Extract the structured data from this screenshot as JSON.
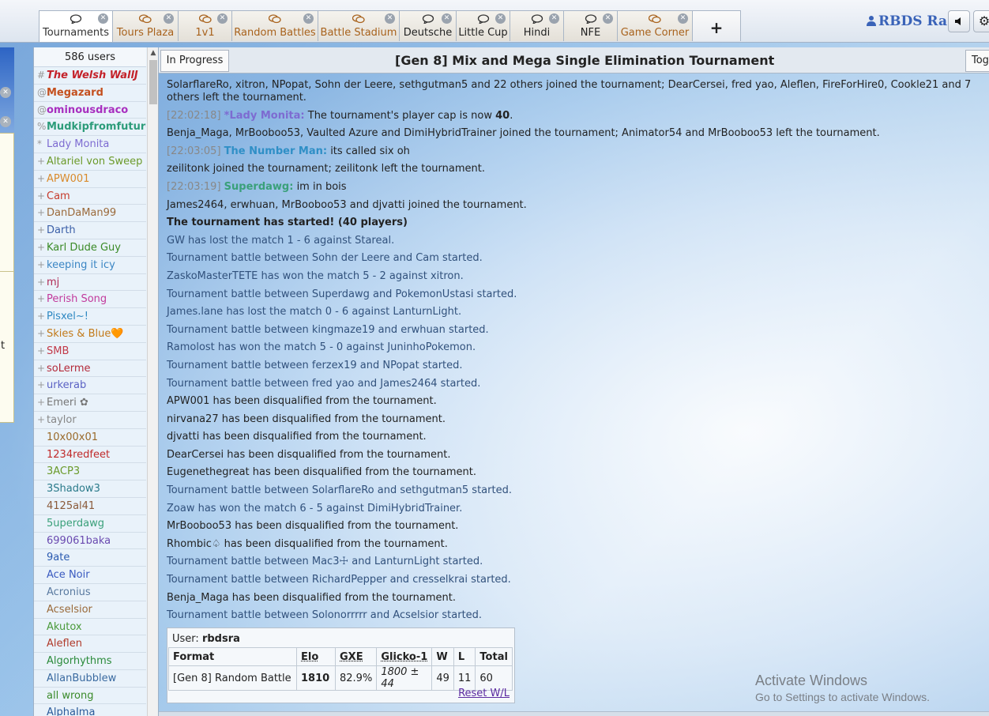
{
  "tabs": [
    {
      "label": "Tournaments",
      "active": true,
      "icon": "chat-bubble-icon",
      "closable": true
    },
    {
      "label": "Tours Plaza",
      "icon": "chat-bubbles-icon",
      "closable": true
    },
    {
      "label": "1v1",
      "icon": "chat-bubbles-icon",
      "closable": true
    },
    {
      "label": "Random Battles",
      "icon": "chat-bubbles-icon",
      "closable": true
    },
    {
      "label": "Battle Stadium",
      "icon": "chat-bubbles-icon",
      "closable": true
    },
    {
      "label": "Deutsche",
      "icon": "chat-bubble-icon",
      "closable": true
    },
    {
      "label": "Little Cup",
      "icon": "chat-bubble-icon",
      "closable": true
    },
    {
      "label": "Hindi",
      "icon": "chat-bubble-icon",
      "closable": true
    },
    {
      "label": "NFE",
      "icon": "chat-bubble-icon",
      "closable": true
    },
    {
      "label": "Game Corner",
      "icon": "chat-bubbles-icon",
      "closable": true
    }
  ],
  "add_tab_label": "+",
  "user": {
    "name": "RBDS Ra",
    "icon": "user-icon"
  },
  "sound_icon": "speaker-icon",
  "settings_icon": "gear-icon",
  "left_panel_partial_text": "t",
  "userlist": {
    "count": "586 users",
    "users": [
      {
        "group": "#",
        "name": "The Welsh WallJ",
        "color": "#c4222a",
        "bold": true,
        "italic": true
      },
      {
        "group": "@",
        "name": "Megazard",
        "color": "#c4501f",
        "bold": true
      },
      {
        "group": "@",
        "name": "ominousdraco",
        "color": "#a82fbf",
        "bold": true
      },
      {
        "group": "%",
        "name": "Mudkipfromfuture",
        "color": "#2d9c7a",
        "bold": true
      },
      {
        "group": "*",
        "name": "Lady Monita",
        "color": "#7d6bd1"
      },
      {
        "group": "+",
        "name": "Altariel von Sweep",
        "color": "#6c9a2a"
      },
      {
        "group": "+",
        "name": "APW001",
        "color": "#d98a2b"
      },
      {
        "group": "+",
        "name": "Cam",
        "color": "#c63a2b"
      },
      {
        "group": "+",
        "name": "DanDaMan99",
        "color": "#9b6a3b"
      },
      {
        "group": "+",
        "name": "Darth",
        "color": "#3b5fa8"
      },
      {
        "group": "+",
        "name": "Karl Dude Guy",
        "color": "#3a8a26"
      },
      {
        "group": "+",
        "name": "keeping it icy",
        "color": "#3b86c4"
      },
      {
        "group": "+",
        "name": "mj",
        "color": "#b02a55"
      },
      {
        "group": "+",
        "name": "Perish Song",
        "color": "#c23a9c"
      },
      {
        "group": "+",
        "name": "Pisxel~!",
        "color": "#2e88c2"
      },
      {
        "group": "+",
        "name": "Skies & Blue🧡",
        "color": "#c27a1a"
      },
      {
        "group": "+",
        "name": "SMB",
        "color": "#c23a4a"
      },
      {
        "group": "+",
        "name": "soLerme",
        "color": "#b42a3a"
      },
      {
        "group": "+",
        "name": "urkerab",
        "color": "#5b62c4"
      },
      {
        "group": "+",
        "name": "Emeri ✿",
        "color": "#777777"
      },
      {
        "group": "+",
        "name": "taylor",
        "color": "#888888"
      },
      {
        "group": "",
        "name": "10x00x01",
        "color": "#9a6a2a"
      },
      {
        "group": "",
        "name": "1234redfeet",
        "color": "#c02a2a"
      },
      {
        "group": "",
        "name": "3ACP3",
        "color": "#6a9a2a"
      },
      {
        "group": "",
        "name": "3Shadow3",
        "color": "#2a7a8a"
      },
      {
        "group": "",
        "name": "4125al41",
        "color": "#8a5a3a"
      },
      {
        "group": "",
        "name": "5uperdawg",
        "color": "#3aa07a"
      },
      {
        "group": "",
        "name": "699061baka",
        "color": "#6a4ab0"
      },
      {
        "group": "",
        "name": "9ate",
        "color": "#2a5ab0"
      },
      {
        "group": "",
        "name": "Ace Noir",
        "color": "#3a5ac0"
      },
      {
        "group": "",
        "name": "Acronius",
        "color": "#5a7aa0"
      },
      {
        "group": "",
        "name": "Acselsior",
        "color": "#9a6a3a"
      },
      {
        "group": "",
        "name": "Akutox",
        "color": "#4a9a3a"
      },
      {
        "group": "",
        "name": "Aleflen",
        "color": "#b03a2a"
      },
      {
        "group": "",
        "name": "Algorhythms",
        "color": "#2a8a3a"
      },
      {
        "group": "",
        "name": "AllanBubblew",
        "color": "#3a6aa0"
      },
      {
        "group": "",
        "name": "all wrong",
        "color": "#3a8a2a"
      },
      {
        "group": "",
        "name": "AlphaIma",
        "color": "#2a5a9a"
      }
    ]
  },
  "room": {
    "status_button": "In Progress",
    "title": "[Gen 8] Mix and Mega Single Elimination Tournament",
    "toggle_button": "Tog"
  },
  "log": [
    {
      "type": "plain",
      "text": "SolarflareRo, xitron, NPopat, Sohn der Leere, sethgutman5 and 22 others joined the tournament; DearCersei, fred yao, Aleflen, FireForHire0, Cookle21 and 7 others left the tournament.",
      "wrap": true
    },
    {
      "type": "chat",
      "time": "[22:02:18]",
      "user": "*Lady Monita:",
      "color": "#7d6bd1",
      "msg": "The tournament's player cap is now ",
      "msg_bold": "40",
      "msg_end": "."
    },
    {
      "type": "plain",
      "text": "Benja_Maga, MrBooboo53, Vaulted Azure and DimiHybridTrainer joined the tournament; Animator54 and MrBooboo53 left the tournament."
    },
    {
      "type": "chat",
      "time": "[22:03:05]",
      "user": "The Number Man:",
      "color": "#2f8fc6",
      "msg": "its called six oh"
    },
    {
      "type": "plain",
      "text": "zeilitonk joined the tournament; zeilitonk left the tournament."
    },
    {
      "type": "chat",
      "time": "[22:03:19]",
      "user": "Superdawg:",
      "color": "#3aa07a",
      "msg": "im in bois"
    },
    {
      "type": "plain",
      "text": "James2464, erwhuan, MrBooboo53 and djvatti joined the tournament."
    },
    {
      "type": "bold",
      "text": "The tournament has started! (40 players)"
    },
    {
      "type": "blue",
      "text": "GW has lost the match 1 - 6 against Stareal."
    },
    {
      "type": "blue",
      "text": "Tournament battle between Sohn der Leere and Cam started."
    },
    {
      "type": "blue",
      "text": "ZaskoMasterTETE has won the match 5 - 2 against xitron."
    },
    {
      "type": "blue",
      "text": "Tournament battle between Superdawg and PokemonUstasi started."
    },
    {
      "type": "blue",
      "text": "James.lane has lost the match 0 - 6 against LanturnLight."
    },
    {
      "type": "blue",
      "text": "Tournament battle between kingmaze19 and erwhuan started."
    },
    {
      "type": "blue",
      "text": "Ramolost has won the match 5 - 0 against JuninhoPokemon."
    },
    {
      "type": "blue",
      "text": "Tournament battle between ferzex19 and NPopat started."
    },
    {
      "type": "blue",
      "text": "Tournament battle between fred yao and James2464 started."
    },
    {
      "type": "plain",
      "text": "APW001 has been disqualified from the tournament."
    },
    {
      "type": "plain",
      "text": "nirvana27 has been disqualified from the tournament."
    },
    {
      "type": "plain",
      "text": "djvatti has been disqualified from the tournament."
    },
    {
      "type": "plain",
      "text": "DearCersei has been disqualified from the tournament."
    },
    {
      "type": "plain",
      "text": "Eugenethegreat has been disqualified from the tournament."
    },
    {
      "type": "blue",
      "text": "Tournament battle between SolarflareRo and sethgutman5 started."
    },
    {
      "type": "blue",
      "text": "Zoaw has won the match 6 - 5 against DimiHybridTrainer."
    },
    {
      "type": "plain",
      "text": "MrBooboo53 has been disqualified from the tournament."
    },
    {
      "type": "plain",
      "text": "Rhombic♤ has been disqualified from the tournament."
    },
    {
      "type": "blue",
      "text": "Tournament battle between Mac3☩ and LanturnLight started."
    },
    {
      "type": "blue",
      "text": "Tournament battle between RichardPepper and cresselkrai started."
    },
    {
      "type": "plain",
      "text": "Benja_Maga has been disqualified from the tournament."
    },
    {
      "type": "blue",
      "text": "Tournament battle between Solonorrrrr and Acselsior started."
    }
  ],
  "stats": {
    "user_label": "User:",
    "user_name": "rbdsra",
    "headers": [
      "Format",
      "Elo",
      "GXE",
      "Glicko-1",
      "W",
      "L",
      "Total"
    ],
    "row": {
      "format": "[Gen 8] Random Battle",
      "elo": "1810",
      "gxe": "82.9%",
      "glicko": "1800 ± 44",
      "w": "49",
      "l": "11",
      "total": "60"
    },
    "reset_label": "Reset W/L"
  },
  "watermark": {
    "line1": "Activate Windows",
    "line2": "Go to Settings to activate Windows."
  }
}
